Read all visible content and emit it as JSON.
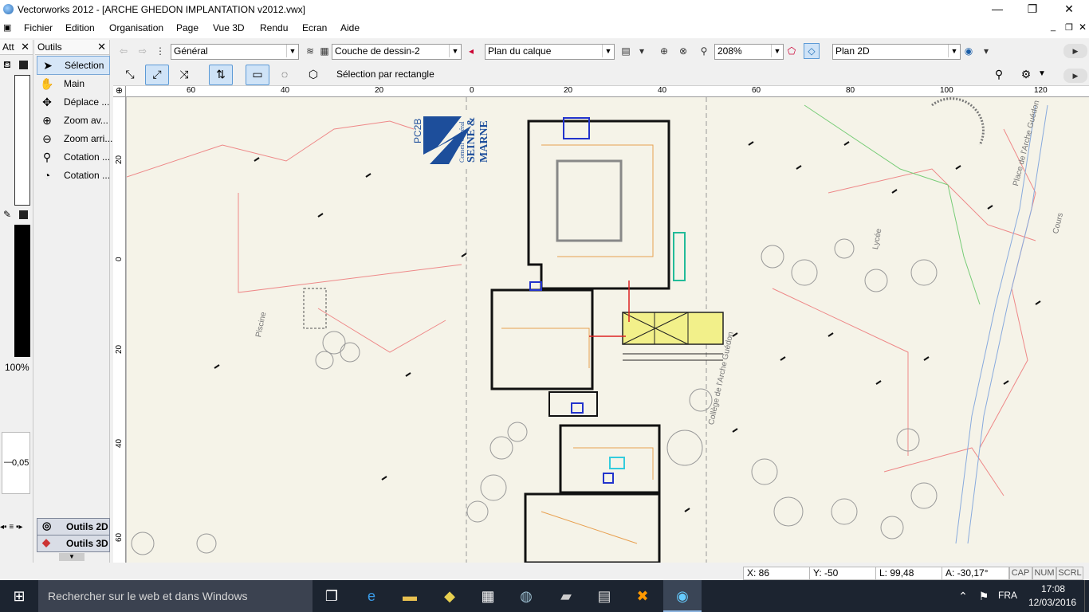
{
  "window": {
    "title": "Vectorworks 2012 - [ARCHE GHEDON IMPLANTATION v2012.vwx]",
    "minimize_icon": "minimize-icon",
    "maximize_icon": "restore-icon",
    "close_icon": "close-icon"
  },
  "menubar": {
    "items": [
      "Fichier",
      "Edition",
      "Organisation",
      "Page",
      "Vue 3D",
      "Rendu",
      "Ecran",
      "Aide"
    ]
  },
  "toolbar": {
    "class_select": "Général",
    "layer_select": "Couche de dessin-2",
    "plane_select": "Plan du calque",
    "zoom": "208%",
    "view_select": "Plan 2D"
  },
  "mode_bar": {
    "mode_label": "Sélection par rectangle"
  },
  "attributes_palette": {
    "title": "Att",
    "opacity": "100%",
    "line_weight": "0,05"
  },
  "tools_palette": {
    "title": "Outils",
    "tools": [
      {
        "label": "Sélection",
        "icon": "arrow-icon"
      },
      {
        "label": "Main",
        "icon": "hand-icon"
      },
      {
        "label": "Déplace ...",
        "icon": "move-icon"
      },
      {
        "label": "Zoom av...",
        "icon": "zoom-in-icon"
      },
      {
        "label": "Zoom arri...",
        "icon": "zoom-out-icon"
      },
      {
        "label": "Cotation ...",
        "icon": "dimension-icon"
      },
      {
        "label": "Cotation ...",
        "icon": "angle-dimension-icon"
      }
    ],
    "sets": [
      "Outils 2D",
      "Outils 3D"
    ]
  },
  "rulers": {
    "top": [
      "60",
      "40",
      "20",
      "0",
      "20",
      "40",
      "60",
      "80",
      "100",
      "120"
    ],
    "left": [
      "20",
      "0",
      "20",
      "40",
      "60"
    ]
  },
  "drawing": {
    "logo_line1": "Conseil Général",
    "logo_line2": "SEINE &",
    "logo_line3": "MARNE",
    "stamp": "PC2B",
    "labels": [
      "Piscine",
      "Lycée",
      "Collège de l'Arche Guédon",
      "Place de l'Arche Guédon",
      "Cours"
    ]
  },
  "statusbar": {
    "x": "X: 86",
    "y": "Y: -50",
    "l": "L: 99,48",
    "a": "A: -30,17°",
    "flags": [
      "CAP",
      "NUM",
      "SCRL"
    ]
  },
  "taskbar": {
    "search_placeholder": "Rechercher sur le web et dans Windows",
    "lang": "FRA",
    "time": "17:08",
    "date": "12/03/2016"
  },
  "colors": {
    "title_bg": "#ffffff",
    "taskbar_bg": "#1c2430",
    "drawing_bg": "#f5f3e8",
    "highlight": "#f2f08a"
  }
}
